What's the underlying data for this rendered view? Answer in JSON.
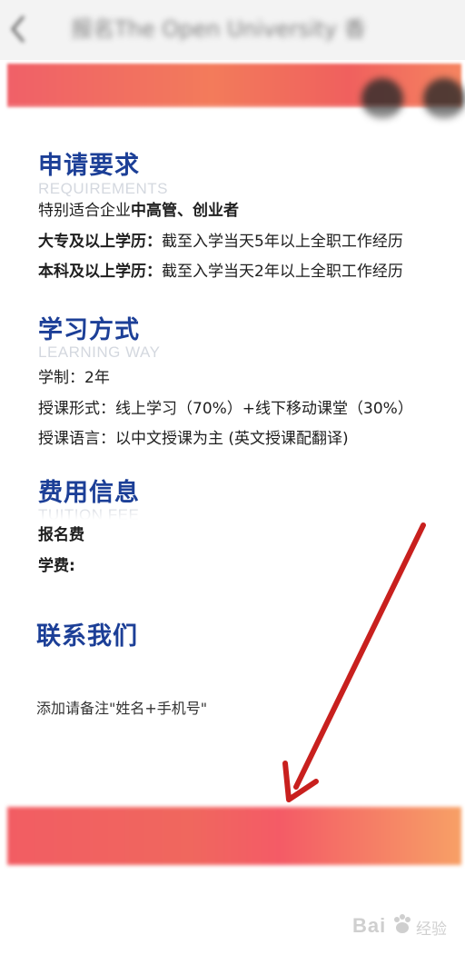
{
  "nav": {
    "back_icon": "chevron-left-icon",
    "title": "报名The Open University 香"
  },
  "requirements": {
    "heading": "申请要求",
    "subheading": "REQUIREMENTS",
    "line1_prefix": "特别适合企业",
    "line1_bold": "中高管、创业者",
    "line2_bold": "大专及以上学历：",
    "line2_text": "截至入学当天5年以上全职工作经历",
    "line3_bold": "本科及以上学历：",
    "line3_text": "截至入学当天2年以上全职工作经历"
  },
  "learning": {
    "heading": "学习方式",
    "subheading": "LEARNING WAY",
    "line1": "学制：2年",
    "line2": "授课形式：线上学习（70%）+线下移动课堂（30%）",
    "line3": "授课语言：以中文授课为主 (英文授课配翻译)"
  },
  "fees": {
    "heading": "费用信息",
    "subheading": "TUITION FEE",
    "registration_label": "报名费",
    "tuition_label": "学费:"
  },
  "contact": {
    "heading": "联系我们",
    "note": "添加请备注\"姓名+手机号\""
  },
  "watermark": {
    "text": "Bai",
    "text_cn": "经验"
  },
  "colors": {
    "heading": "#1c3f97",
    "banner": "#f06068",
    "arrow": "#c8201e"
  }
}
